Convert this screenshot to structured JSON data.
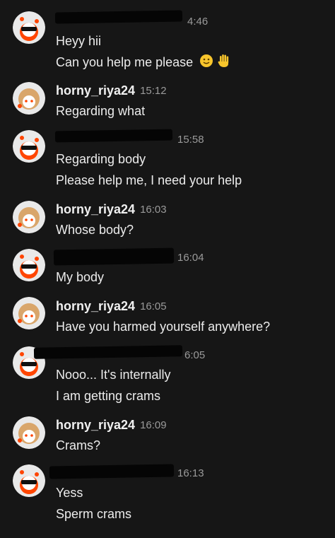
{
  "chat": {
    "groups": [
      {
        "user": "",
        "time": "4:46",
        "redacted": true,
        "avatar": "redditor-sunglasses-avatar",
        "messages": [
          "Heyy hii",
          "Can you help me please"
        ]
      },
      {
        "user": "horny_riya24",
        "time": "15:12",
        "redacted": false,
        "avatar": "redditor-blonde-avatar",
        "messages": [
          "Regarding what"
        ]
      },
      {
        "user": "",
        "time": "15:58",
        "redacted": true,
        "avatar": "redditor-sunglasses-avatar",
        "messages": [
          "Regarding body",
          "Please help me, I need your help"
        ]
      },
      {
        "user": "horny_riya24",
        "time": "16:03",
        "redacted": false,
        "avatar": "redditor-blonde-avatar",
        "messages": [
          "Whose body?"
        ]
      },
      {
        "user": "",
        "time": "16:04",
        "redacted": true,
        "avatar": "redditor-sunglasses-avatar",
        "messages": [
          "My body"
        ]
      },
      {
        "user": "horny_riya24",
        "time": "16:05",
        "redacted": false,
        "avatar": "redditor-blonde-avatar",
        "messages": [
          "Have you harmed yourself anywhere?"
        ]
      },
      {
        "user": "",
        "time": "6:05",
        "redacted": true,
        "avatar": "redditor-sunglasses-avatar",
        "messages": [
          "Nooo... It's internally",
          "I am getting crams"
        ]
      },
      {
        "user": "horny_riya24",
        "time": "16:09",
        "redacted": false,
        "avatar": "redditor-blonde-avatar",
        "messages": [
          "Crams?"
        ]
      },
      {
        "user": "",
        "time": "16:13",
        "redacted": true,
        "avatar": "redditor-sunglasses-avatar",
        "messages": [
          "Yess",
          "Sperm crams"
        ]
      }
    ],
    "emojis": [
      "slightly-smiling-face-emoji",
      "raised-hand-emoji"
    ]
  }
}
